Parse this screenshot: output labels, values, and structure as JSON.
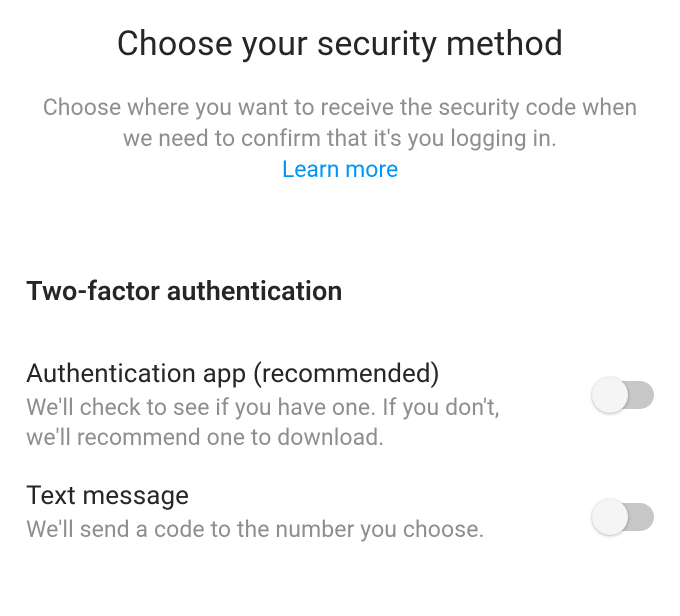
{
  "header": {
    "title": "Choose your security method",
    "subtitle": "Choose where you want to receive the security code when we need to confirm that it's you logging in.",
    "learn_more": "Learn more"
  },
  "section": {
    "title": "Two-factor authentication"
  },
  "options": {
    "auth_app": {
      "title": "Authentication app (recommended)",
      "desc": "We'll check to see if you have one. If you don't, we'll recommend one to download.",
      "enabled": false
    },
    "text_message": {
      "title": "Text message",
      "desc": "We'll send a code to the number you choose.",
      "enabled": false
    }
  }
}
